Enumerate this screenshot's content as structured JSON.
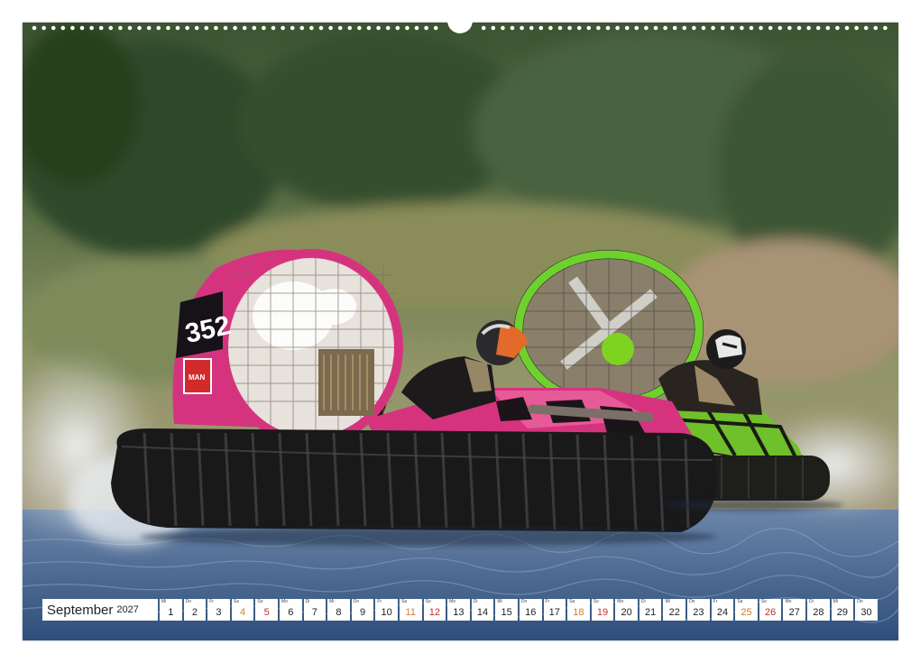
{
  "calendar": {
    "month": "September",
    "year": "2027",
    "days": [
      {
        "abbr": "Mi",
        "num": "1",
        "type": "weekday"
      },
      {
        "abbr": "Do",
        "num": "2",
        "type": "weekday"
      },
      {
        "abbr": "Fr",
        "num": "3",
        "type": "weekday"
      },
      {
        "abbr": "Sa",
        "num": "4",
        "type": "sat"
      },
      {
        "abbr": "So",
        "num": "5",
        "type": "sun"
      },
      {
        "abbr": "Mo",
        "num": "6",
        "type": "weekday"
      },
      {
        "abbr": "Di",
        "num": "7",
        "type": "weekday"
      },
      {
        "abbr": "Mi",
        "num": "8",
        "type": "weekday"
      },
      {
        "abbr": "Do",
        "num": "9",
        "type": "weekday"
      },
      {
        "abbr": "Fr",
        "num": "10",
        "type": "weekday"
      },
      {
        "abbr": "Sa",
        "num": "11",
        "type": "sat"
      },
      {
        "abbr": "So",
        "num": "12",
        "type": "sun"
      },
      {
        "abbr": "Mo",
        "num": "13",
        "type": "weekday"
      },
      {
        "abbr": "Di",
        "num": "14",
        "type": "weekday"
      },
      {
        "abbr": "Mi",
        "num": "15",
        "type": "weekday"
      },
      {
        "abbr": "Do",
        "num": "16",
        "type": "weekday"
      },
      {
        "abbr": "Fr",
        "num": "17",
        "type": "weekday"
      },
      {
        "abbr": "Sa",
        "num": "18",
        "type": "sat"
      },
      {
        "abbr": "So",
        "num": "19",
        "type": "sun"
      },
      {
        "abbr": "Mo",
        "num": "20",
        "type": "weekday"
      },
      {
        "abbr": "Di",
        "num": "21",
        "type": "weekday"
      },
      {
        "abbr": "Mi",
        "num": "22",
        "type": "weekday"
      },
      {
        "abbr": "Do",
        "num": "23",
        "type": "weekday"
      },
      {
        "abbr": "Fr",
        "num": "24",
        "type": "weekday"
      },
      {
        "abbr": "Sa",
        "num": "25",
        "type": "sat"
      },
      {
        "abbr": "So",
        "num": "26",
        "type": "sun"
      },
      {
        "abbr": "Mo",
        "num": "27",
        "type": "weekday"
      },
      {
        "abbr": "Di",
        "num": "28",
        "type": "weekday"
      },
      {
        "abbr": "Mi",
        "num": "29",
        "type": "weekday"
      },
      {
        "abbr": "Do",
        "num": "30",
        "type": "weekday"
      }
    ]
  },
  "photo": {
    "hovercraft_front": {
      "race_number": "352",
      "sponsor": "MAN"
    },
    "colors": {
      "pink_craft": "#d6337f",
      "green_craft": "#7ed321",
      "water": "#3f5f8a",
      "foliage": "#4a6a3a",
      "saturday": "#d87a2a",
      "sunday": "#c0302a"
    }
  }
}
